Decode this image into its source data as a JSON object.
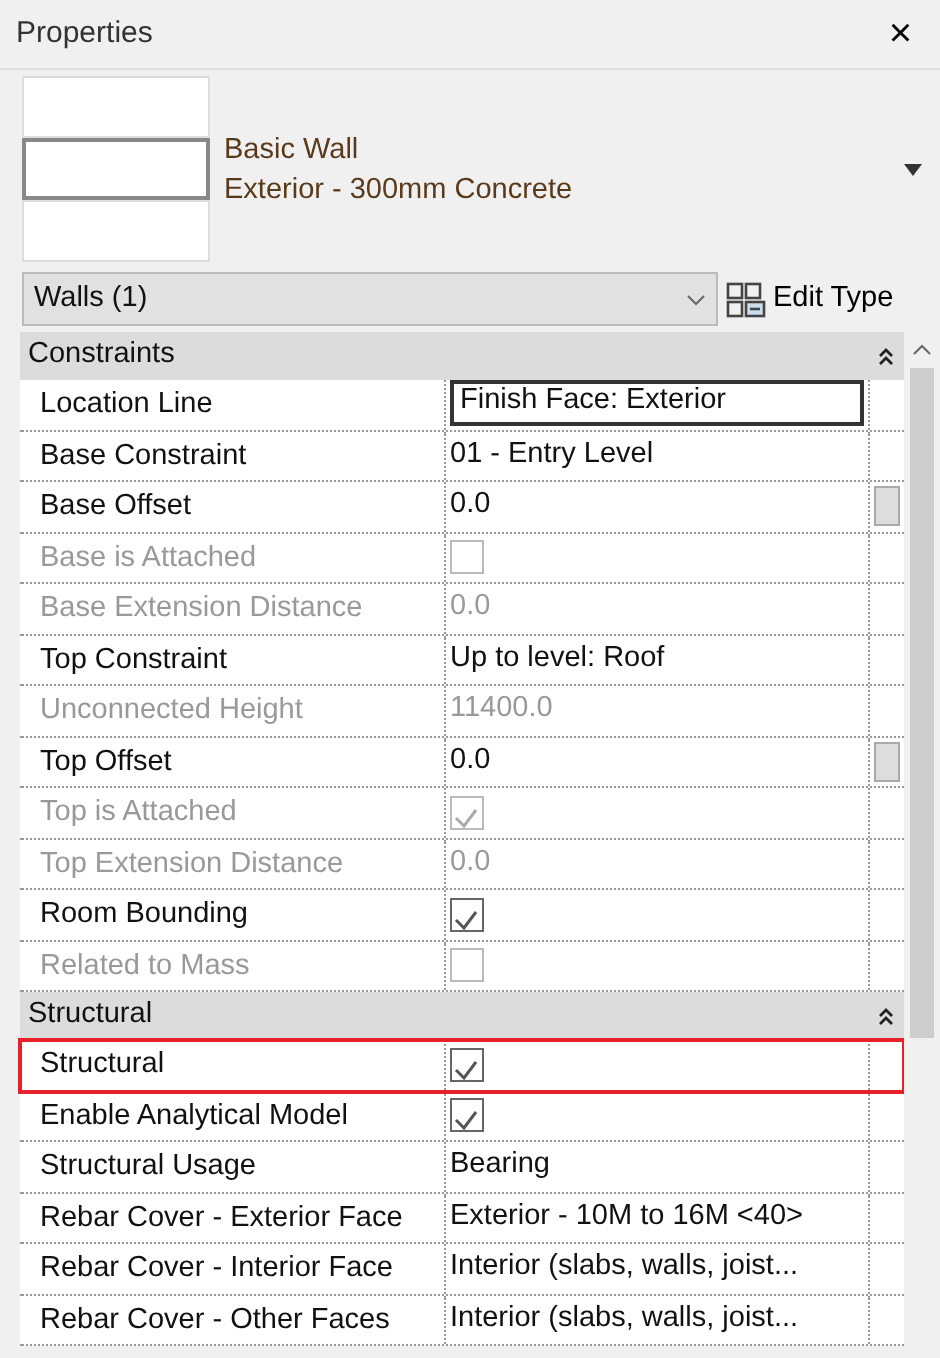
{
  "window": {
    "title": "Properties",
    "close": "×"
  },
  "type_selector": {
    "family": "Basic Wall",
    "type": "Exterior - 300mm Concrete"
  },
  "filter": {
    "value": "Walls (1)",
    "edit_type": "Edit Type"
  },
  "sections": [
    {
      "title": "Constraints",
      "expanded": true,
      "rows": [
        {
          "label": "Location Line",
          "kind": "input",
          "value": "Finish Face: Exterior",
          "disabled": false,
          "highlighted": false
        },
        {
          "label": "Base Constraint",
          "kind": "text",
          "value": "01 - Entry Level",
          "disabled": false,
          "highlighted": false
        },
        {
          "label": "Base Offset",
          "kind": "number",
          "value": "0.0",
          "disabled": false,
          "highlighted": false
        },
        {
          "label": "Base is Attached",
          "kind": "checkbox",
          "checked": false,
          "disabled": true,
          "highlighted": false
        },
        {
          "label": "Base Extension Distance",
          "kind": "text",
          "value": "0.0",
          "disabled": true,
          "highlighted": false
        },
        {
          "label": "Top Constraint",
          "kind": "text",
          "value": "Up to level: Roof",
          "disabled": false,
          "highlighted": false
        },
        {
          "label": "Unconnected Height",
          "kind": "text",
          "value": "11400.0",
          "disabled": true,
          "highlighted": false
        },
        {
          "label": "Top Offset",
          "kind": "number",
          "value": "0.0",
          "disabled": false,
          "highlighted": false
        },
        {
          "label": "Top is Attached",
          "kind": "checkbox",
          "checked": true,
          "disabled": true,
          "highlighted": false
        },
        {
          "label": "Top Extension Distance",
          "kind": "text",
          "value": "0.0",
          "disabled": true,
          "highlighted": false
        },
        {
          "label": "Room Bounding",
          "kind": "checkbox",
          "checked": true,
          "disabled": false,
          "highlighted": false
        },
        {
          "label": "Related to Mass",
          "kind": "checkbox",
          "checked": false,
          "disabled": true,
          "highlighted": false
        }
      ]
    },
    {
      "title": "Structural",
      "expanded": true,
      "rows": [
        {
          "label": "Structural",
          "kind": "checkbox",
          "checked": true,
          "disabled": false,
          "highlighted": true
        },
        {
          "label": "Enable Analytical Model",
          "kind": "checkbox",
          "checked": true,
          "disabled": false,
          "highlighted": false
        },
        {
          "label": "Structural Usage",
          "kind": "text",
          "value": "Bearing",
          "disabled": false,
          "highlighted": false
        },
        {
          "label": "Rebar Cover - Exterior Face",
          "kind": "text",
          "value": "Exterior - 10M to 16M <40>",
          "disabled": false,
          "highlighted": false
        },
        {
          "label": "Rebar Cover - Interior Face",
          "kind": "text",
          "value": "Interior (slabs, walls, joist...",
          "disabled": false,
          "highlighted": false
        },
        {
          "label": "Rebar Cover - Other Faces",
          "kind": "text",
          "value": "Interior (slabs, walls, joist...",
          "disabled": false,
          "highlighted": false
        }
      ]
    }
  ]
}
